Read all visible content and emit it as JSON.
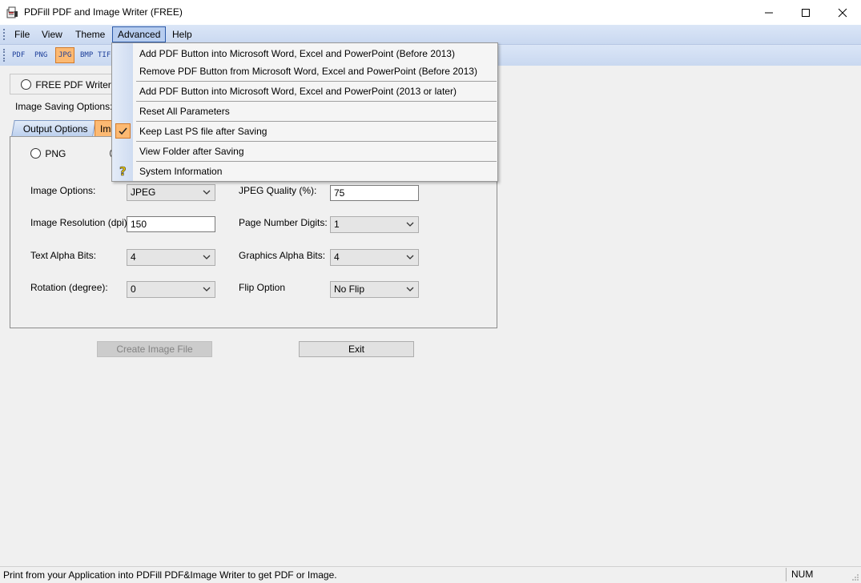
{
  "window": {
    "title": "PDFill PDF and Image Writer (FREE)",
    "minimize_glyph": "—",
    "maximize_glyph": "☐",
    "close_glyph": "✕"
  },
  "menubar": {
    "items": [
      "File",
      "View",
      "Theme",
      "Advanced",
      "Help"
    ],
    "active": "Advanced"
  },
  "toolbar": {
    "buttons": [
      "PDF",
      "PNG",
      "JPG",
      "BMP",
      "TIF"
    ],
    "active": "JPG"
  },
  "main": {
    "free_pdf_writer_label": "FREE PDF Writer (Pr",
    "image_saving_options_label": "Image Saving Options:",
    "tabs": [
      "Output Options",
      "Ima"
    ],
    "active_tab": "Ima",
    "format_png_label": "PNG",
    "image_options_label": "Image Options:",
    "image_options_value": "JPEG",
    "jpeg_quality_label": "JPEG Quality (%):",
    "jpeg_quality_value": "75",
    "image_resolution_label": "Image Resolution (dpi):",
    "image_resolution_value": "150",
    "page_number_digits_label": "Page Number Digits:",
    "page_number_digits_value": "1",
    "text_alpha_bits_label": "Text Alpha Bits:",
    "text_alpha_bits_value": "4",
    "graphics_alpha_bits_label": "Graphics Alpha Bits:",
    "graphics_alpha_bits_value": "4",
    "rotation_label": "Rotation (degree):",
    "rotation_value": "0",
    "flip_option_label": "Flip Option",
    "flip_option_value": "No Flip",
    "create_image_button": "Create Image File",
    "exit_button": "Exit"
  },
  "advanced_menu": {
    "items": [
      {
        "label": "Add PDF Button into Microsoft Word, Excel and PowerPoint (Before 2013)",
        "checked": false
      },
      {
        "label": "Remove PDF Button from Microsoft Word, Excel and PowerPoint (Before 2013)",
        "checked": false
      },
      {
        "label": "Add PDF Button into Microsoft Word, Excel and PowerPoint (2013 or later)",
        "checked": false
      },
      {
        "label": "Reset All Parameters",
        "checked": false
      },
      {
        "label": "Keep Last PS file after Saving",
        "checked": true
      },
      {
        "label": "View Folder after Saving",
        "checked": false
      },
      {
        "label": "System Information",
        "checked": false,
        "icon": "help-question-icon"
      }
    ]
  },
  "statusbar": {
    "message": "Print from your Application into PDFill PDF&Image Writer to get PDF or Image.",
    "num_indicator": "NUM"
  },
  "colors": {
    "menu_highlight": "#b7cdef",
    "check_orange": "#fcb972",
    "toolbar_gradient_top": "#dbe6f7"
  }
}
